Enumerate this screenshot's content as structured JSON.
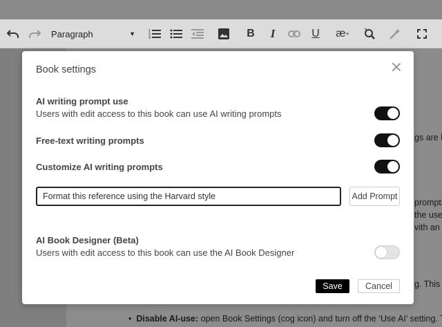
{
  "toolbar": {
    "block_format": "Paragraph",
    "icons": [
      "undo-icon",
      "redo-icon",
      "numbered-list-icon",
      "bullet-list-icon",
      "outdent-icon",
      "image-icon",
      "bold-icon",
      "italic-icon",
      "link-icon",
      "underline-icon",
      "special-character-icon",
      "find-replace-icon",
      "ai-magic-icon",
      "fullscreen-icon"
    ]
  },
  "background": {
    "line1": "gs are lin",
    "line2": "prompts",
    "line3": "the use",
    "line4": "vith an A",
    "line5": "g. This a",
    "bullet_bold": "Disable AI-use:",
    "bullet_rest": " open Book Settings (cog icon) and turn off the ‘Use AI’ setting. This r"
  },
  "modal": {
    "title": "Book settings",
    "settings": {
      "ai_prompt_use": {
        "title": "AI writing prompt use",
        "description": "Users with edit access to this book can use AI writing prompts",
        "enabled": true
      },
      "free_text": {
        "title": "Free-text writing prompts",
        "enabled": true
      },
      "customize": {
        "title": "Customize AI writing prompts",
        "enabled": true
      },
      "book_designer": {
        "title": "AI Book Designer (Beta)",
        "description": "Users with edit access to this book can use the AI Book Designer",
        "enabled": false
      }
    },
    "prompt_input": {
      "value": "Format this reference using the Harvard style"
    },
    "add_prompt_label": "Add Prompt",
    "save_label": "Save",
    "cancel_label": "Cancel"
  }
}
